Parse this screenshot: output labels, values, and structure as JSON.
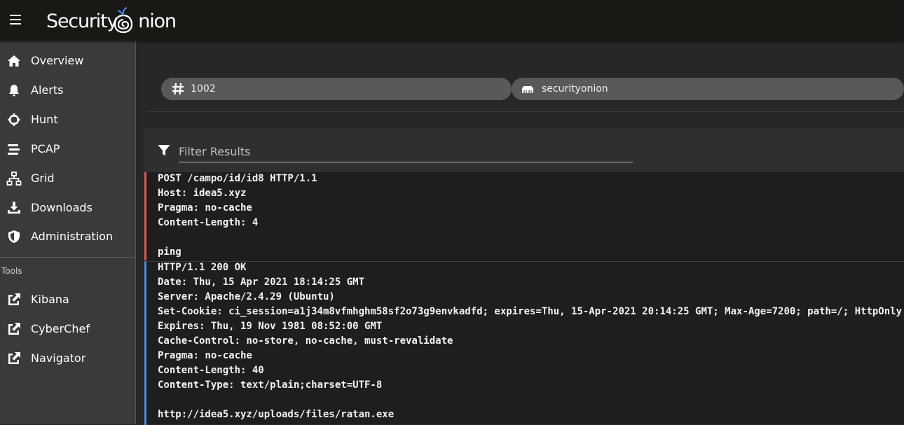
{
  "app": {
    "brand": "Security",
    "brand_suffix": "nion"
  },
  "sidebar": {
    "items": [
      {
        "label": "Overview",
        "icon": "home-icon"
      },
      {
        "label": "Alerts",
        "icon": "bell-icon"
      },
      {
        "label": "Hunt",
        "icon": "crosshairs-icon"
      },
      {
        "label": "PCAP",
        "icon": "stream-icon"
      },
      {
        "label": "Grid",
        "icon": "sitemap-icon"
      },
      {
        "label": "Downloads",
        "icon": "download-icon"
      },
      {
        "label": "Administration",
        "icon": "shield-icon"
      }
    ],
    "tools_label": "Tools",
    "tools": [
      {
        "label": "Kibana",
        "icon": "external-link-icon"
      },
      {
        "label": "CyberChef",
        "icon": "external-link-icon"
      },
      {
        "label": "Navigator",
        "icon": "external-link-icon"
      }
    ]
  },
  "chips": {
    "id": "1002",
    "sensor": "securityonion"
  },
  "filter": {
    "placeholder": "Filter Results"
  },
  "transcript": {
    "request": [
      "POST /campo/id/id8 HTTP/1.1",
      "Host: idea5.xyz",
      "Pragma: no-cache",
      "Content-Length: 4",
      "",
      "ping"
    ],
    "response": [
      "HTTP/1.1 200 OK",
      "Date: Thu, 15 Apr 2021 18:14:25 GMT",
      "Server: Apache/2.4.29 (Ubuntu)",
      "Set-Cookie: ci_session=a1j34m8vfmhghm58sf2o73g9envkadfd; expires=Thu, 15-Apr-2021 20:14:25 GMT; Max-Age=7200; path=/; HttpOnly",
      "Expires: Thu, 19 Nov 1981 08:52:00 GMT",
      "Cache-Control: no-store, no-cache, must-revalidate",
      "Pragma: no-cache",
      "Content-Length: 40",
      "Content-Type: text/plain;charset=UTF-8",
      "",
      "http://idea5.xyz/uploads/files/ratan.exe"
    ]
  },
  "colors": {
    "request_border": "#e05656",
    "response_border": "#3f8ee0",
    "logo_accent": "#3f8ee0"
  }
}
